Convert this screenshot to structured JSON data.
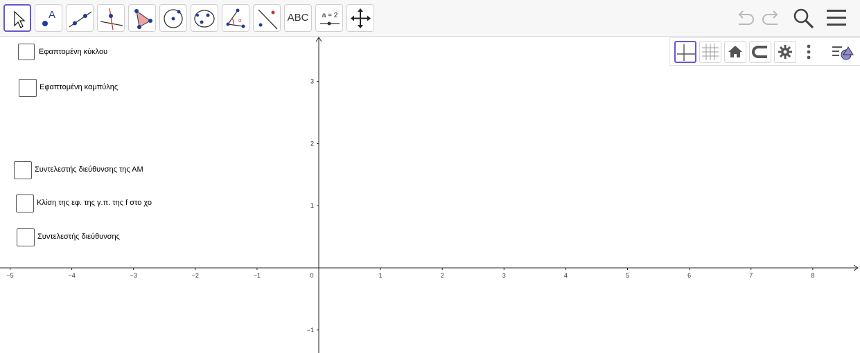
{
  "toolbar": {
    "tools": [
      {
        "name": "move-tool",
        "icon": "cursor-arrow-icon"
      },
      {
        "name": "point-tool",
        "icon": "point-icon",
        "letter": "A"
      },
      {
        "name": "line-tool",
        "icon": "line-through-points-icon"
      },
      {
        "name": "perpendicular-line-tool",
        "icon": "perpendicular-line-icon"
      },
      {
        "name": "polygon-tool",
        "icon": "polygon-icon"
      },
      {
        "name": "circle-tool",
        "icon": "circle-center-point-icon"
      },
      {
        "name": "ellipse-tool",
        "icon": "conic-five-points-icon"
      },
      {
        "name": "angle-tool",
        "icon": "angle-icon",
        "letter": "α"
      },
      {
        "name": "reflect-tool",
        "icon": "reflect-about-line-icon"
      },
      {
        "name": "text-tool",
        "icon": "text-icon",
        "label": "ABC"
      },
      {
        "name": "slider-tool",
        "icon": "slider-icon",
        "label": "a = 2"
      },
      {
        "name": "move-view-tool",
        "icon": "move-graphics-view-icon"
      }
    ],
    "right_icons": [
      "undo-icon",
      "redo-icon",
      "search-icon",
      "menu-icon"
    ]
  },
  "stylebar": {
    "buttons": [
      "axes-icon",
      "grid-icon",
      "home-icon",
      "magnet-snap-icon",
      "gear-icon",
      "more-vertical-icon",
      "view-toggle-icon"
    ]
  },
  "checkboxes": [
    {
      "label": "Εφαπτομένη κύκλου",
      "checked": false
    },
    {
      "label": "Εφαπτομένη καμπύλης",
      "checked": false
    },
    {
      "label": "Συντελεστής διεύθυνσης της ΑΜ",
      "checked": false
    },
    {
      "label": "Κλίση της εφ. της γ.π. της f στο χο",
      "checked": false
    },
    {
      "label": "Συντελεστής διεύθυνσης",
      "checked": false
    }
  ],
  "axes": {
    "x_ticks": [
      "−5",
      "−4",
      "−3",
      "−2",
      "−1",
      "0",
      "1",
      "2",
      "3",
      "4",
      "5",
      "6",
      "7",
      "8"
    ],
    "y_ticks": [
      "3",
      "2",
      "1",
      "−1"
    ],
    "x_range": [
      -5.2,
      8.8
    ],
    "y_range": [
      -1.35,
      3.7
    ],
    "axis_color": "#252525"
  },
  "colors": {
    "accent": "#6557d2",
    "point_blue": "#1f3c9b",
    "polygon_fill": "#e8a3a3",
    "undo_disabled": "#b9b9b9",
    "icon_dark": "#444444"
  }
}
